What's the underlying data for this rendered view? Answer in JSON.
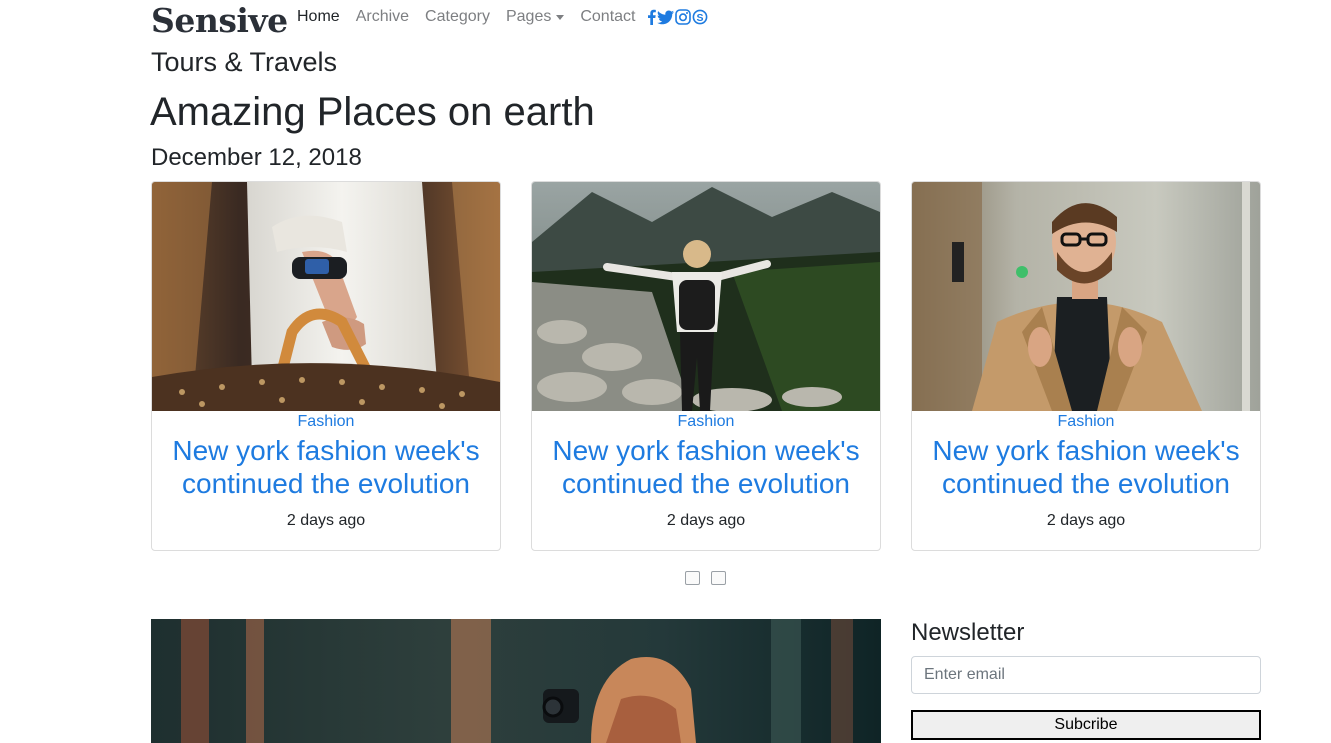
{
  "brand": "Sensive",
  "nav": {
    "home": "Home",
    "archive": "Archive",
    "category": "Category",
    "pages": "Pages",
    "contact": "Contact"
  },
  "social_icons": [
    "facebook-icon",
    "twitter-icon",
    "instagram-icon",
    "skype-icon"
  ],
  "tagline": "Tours & Travels",
  "headline": "Amazing Places on earth",
  "date": "December 12, 2018",
  "cards": [
    {
      "category": "Fashion",
      "title": "New york fashion week's continued the evolution",
      "time": "2 days ago"
    },
    {
      "category": "Fashion",
      "title": "New york fashion week's continued the evolution",
      "time": "2 days ago"
    },
    {
      "category": "Fashion",
      "title": "New york fashion week's continued the evolution",
      "time": "2 days ago"
    }
  ],
  "newsletter": {
    "title": "Newsletter",
    "placeholder": "Enter email",
    "button": "Subcribe"
  },
  "colors": {
    "link": "#1e7be0",
    "text": "#212529",
    "nav_muted": "#7d7f82"
  }
}
